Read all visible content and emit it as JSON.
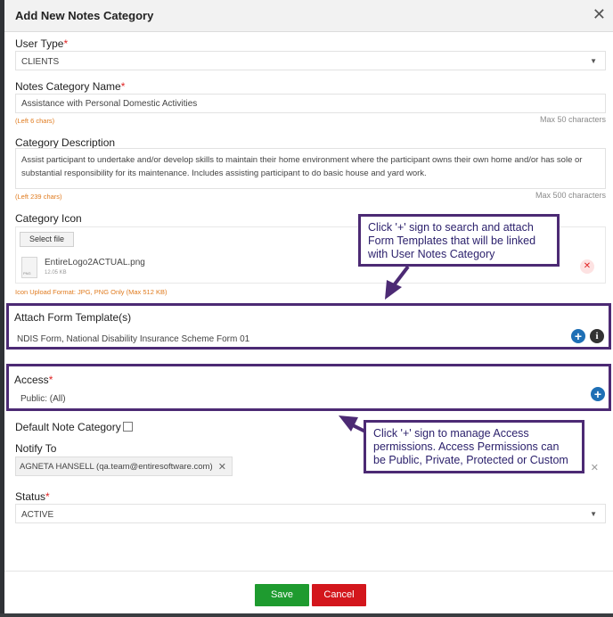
{
  "header": {
    "title": "Add New Notes Category",
    "close_glyph": "✕"
  },
  "user_type": {
    "label": "User Type",
    "required": "*",
    "value": "CLIENTS",
    "caret": "▼"
  },
  "notes_category_name": {
    "label": "Notes Category Name",
    "required": "*",
    "value": "Assistance with Personal Domestic Activities",
    "left_hint": "(Left 6 chars)",
    "max_hint": "Max 50 characters"
  },
  "category_description": {
    "label": "Category Description",
    "value": "Assist participant to undertake and/or develop skills to maintain their home environment where the participant owns their own home and/or has sole or substantial responsibility for its maintenance. Includes assisting participant to do basic house and yard work.",
    "left_hint": "(Left 239 chars)",
    "max_hint": "Max 500 characters"
  },
  "category_icon": {
    "label": "Category Icon",
    "select_file_label": "Select file",
    "file_name": "EntireLogo2ACTUAL.png",
    "file_size": "12.05 KB",
    "thumb_ext": "PNG",
    "remove_glyph": "✕",
    "upload_hint": "Icon Upload Format: JPG, PNG Only (Max 512 KB)"
  },
  "attach_form_templates": {
    "label": "Attach Form Template(s)",
    "value": "NDIS Form, National Disability Insurance Scheme Form 01",
    "add_glyph": "+",
    "info_glyph": "i"
  },
  "access": {
    "label": "Access",
    "required": "*",
    "value": "Public: (All)",
    "add_glyph": "+"
  },
  "default_note_category": {
    "label": "Default Note Category"
  },
  "notify_to": {
    "label": "Notify To",
    "tag": "AGNETA HANSELL (qa.team@entiresoftware.com)",
    "tag_remove_glyph": "✕",
    "clear_glyph": "✕"
  },
  "status": {
    "label": "Status",
    "required": "*",
    "value": "ACTIVE",
    "caret": "▼"
  },
  "footer": {
    "save_label": "Save",
    "cancel_label": "Cancel"
  },
  "callouts": {
    "form_templates": [
      "Click '+' sign to search and attach",
      "Form Templates that will be linked",
      "with User Notes Category"
    ],
    "access": [
      "Click '+' sign to manage Access",
      "permissions. Access Permissions can",
      "be Public, Private, Protected or Custom"
    ]
  },
  "colors": {
    "highlight": "#4c2a74",
    "save": "#1e9b2f",
    "cancel": "#d3161c",
    "plus": "#1e6fb5",
    "required": "#e02424",
    "hint": "#e07b1f"
  }
}
